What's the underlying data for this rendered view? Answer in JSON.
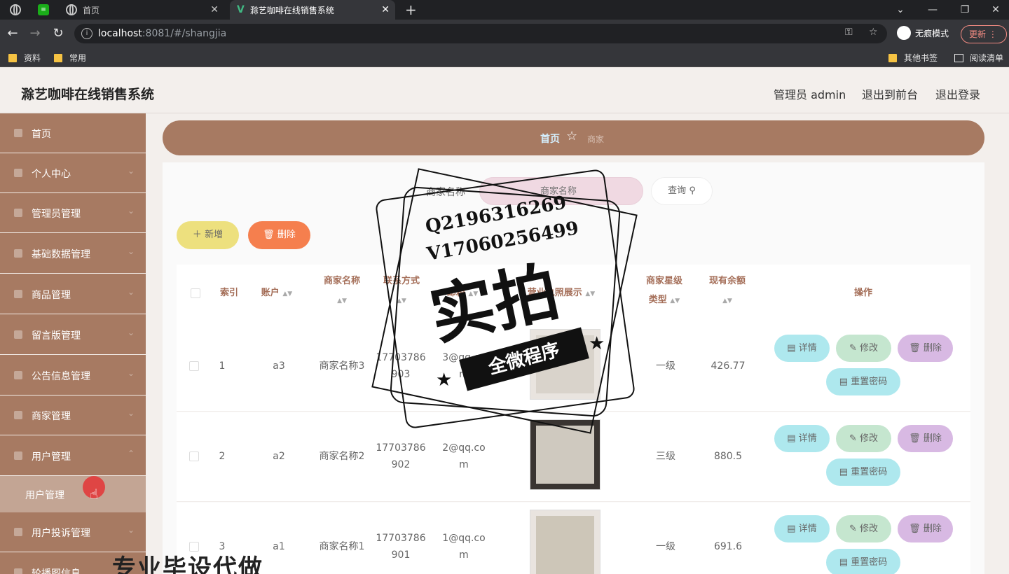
{
  "browser": {
    "tabs": [
      {
        "label": "首页"
      },
      {
        "label": "滁艺咖啡在线销售系统"
      }
    ],
    "url_host": "localhost",
    "url_rest": ":8081/#/shangjia",
    "incognito_label": "无痕模式",
    "update_label": "更新",
    "bookmarks": [
      "资料",
      "常用"
    ],
    "bookmarks_right": [
      "其他书签",
      "阅读清单"
    ]
  },
  "header": {
    "title": "滁艺咖啡在线销售系统",
    "user_label": "管理员 admin",
    "front_label": "退出到前台",
    "logout_label": "退出登录"
  },
  "sidebar": {
    "items": [
      {
        "label": "首页"
      },
      {
        "label": "个人中心"
      },
      {
        "label": "管理员管理"
      },
      {
        "label": "基础数据管理"
      },
      {
        "label": "商品管理"
      },
      {
        "label": "留言版管理"
      },
      {
        "label": "公告信息管理"
      },
      {
        "label": "商家管理"
      },
      {
        "label": "用户管理"
      },
      {
        "label": "用户投诉管理"
      },
      {
        "label": "轮播图信息"
      }
    ],
    "sub_item": "用户管理"
  },
  "breadcrumb": {
    "home": "首页",
    "current": "商家"
  },
  "search": {
    "label": "商家名称",
    "placeholder": "商家名称",
    "button": "查询"
  },
  "actions": {
    "add": "新增",
    "delete": "删除"
  },
  "table": {
    "headers": {
      "index": "索引",
      "account": "账户",
      "name": "商家名称",
      "phone": "联系方式",
      "email": "邮箱",
      "photo": "营业执照展示",
      "star_line1": "商家星级",
      "star_line2": "类型",
      "balance": "现有余额",
      "ops": "操作"
    },
    "rows": [
      {
        "index": "1",
        "account": "a3",
        "name": "商家名称3",
        "phone1": "17703786",
        "phone2": "903",
        "email1": "3@qq.co",
        "email2": "m",
        "star": "一级",
        "balance": "426.77"
      },
      {
        "index": "2",
        "account": "a2",
        "name": "商家名称2",
        "phone1": "17703786",
        "phone2": "902",
        "email1": "2@qq.co",
        "email2": "m",
        "star": "三级",
        "balance": "880.5"
      },
      {
        "index": "3",
        "account": "a1",
        "name": "商家名称1",
        "phone1": "17703786",
        "phone2": "901",
        "email1": "1@qq.co",
        "email2": "m",
        "star": "一级",
        "balance": "691.6"
      }
    ],
    "ops": {
      "detail": "详情",
      "edit": "修改",
      "delete": "删除",
      "reset": "重置密码"
    }
  },
  "watermark": {
    "qq": "Q2196316269",
    "vx": "V17060256499",
    "big": "实拍",
    "band": "全微程序",
    "bottom": "专业毕设代做"
  }
}
